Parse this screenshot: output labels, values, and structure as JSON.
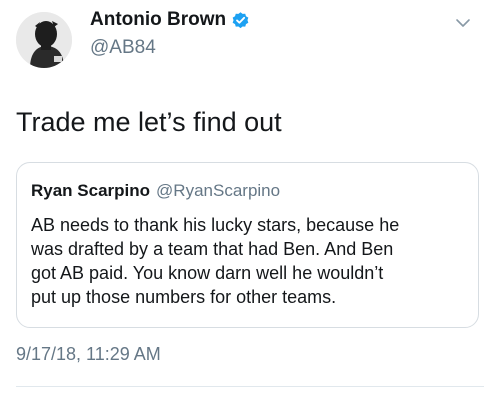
{
  "author": {
    "display_name": "Antonio Brown",
    "handle": "@AB84",
    "verified": true
  },
  "tweet": {
    "text": "Trade me let’s find out",
    "timestamp": "9/17/18, 11:29 AM"
  },
  "quoted_tweet": {
    "display_name": "Ryan Scarpino",
    "handle": "@RyanScarpino",
    "text_lines": [
      "AB needs to thank his lucky stars, because he",
      "was drafted by a team that had Ben. And Ben",
      "got AB paid. You know darn well he wouldn’t",
      "put up those numbers for other teams."
    ]
  },
  "icons": {
    "avatar": "profile-photo",
    "verified": "verified-check-icon",
    "caret": "chevron-down-icon"
  },
  "colors": {
    "verified_blue": "#1da1f2",
    "secondary_text": "#657786",
    "primary_text": "#14171a",
    "border": "#d7dde2"
  }
}
